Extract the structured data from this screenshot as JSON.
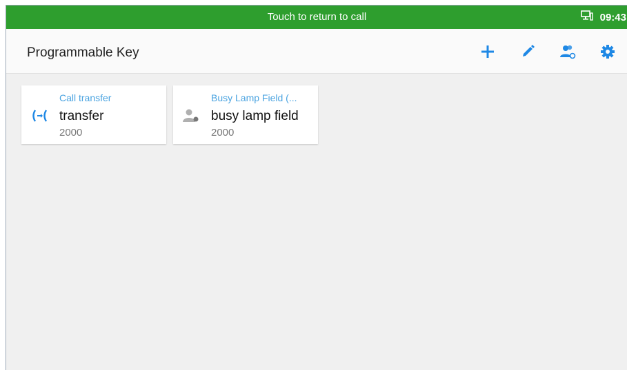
{
  "call_banner": {
    "text": "Touch to return to call"
  },
  "status_bar": {
    "time": "09:43",
    "icon": "network-icon"
  },
  "app_bar": {
    "title": "Programmable Key",
    "actions": [
      {
        "name": "add-icon",
        "color": "#1e88e5"
      },
      {
        "name": "edit-icon",
        "color": "#1e88e5"
      },
      {
        "name": "contacts-icon",
        "color": "#1e88e5"
      },
      {
        "name": "settings-icon",
        "color": "#1e88e5"
      }
    ]
  },
  "keys": [
    {
      "type": "Call transfer",
      "name": "transfer",
      "number": "2000",
      "icon": "call-transfer-icon"
    },
    {
      "type": "Busy Lamp Field (...",
      "name": "busy lamp field",
      "number": "2000",
      "icon": "contact-person-icon"
    }
  ],
  "colors": {
    "call_banner": "#2e9e2e",
    "accent": "#1e88e5",
    "label_blue": "#4aa3e0",
    "background": "#f0f0f0"
  }
}
